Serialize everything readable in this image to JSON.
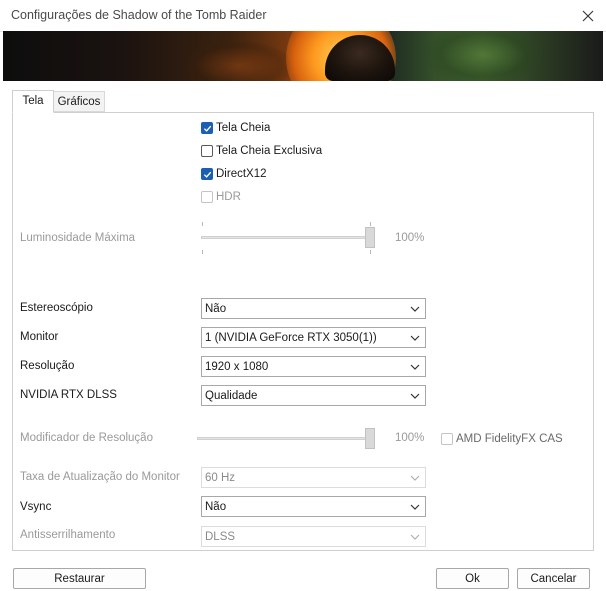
{
  "window": {
    "title": "Configurações de Shadow of the Tomb Raider"
  },
  "tabs": [
    {
      "label": "Tela",
      "active": true
    },
    {
      "label": "Gráficos",
      "active": false
    }
  ],
  "checkboxes": {
    "fullscreen": {
      "label": "Tela Cheia",
      "checked": true
    },
    "exclusive_fullscreen": {
      "label": "Tela Cheia Exclusiva",
      "checked": false
    },
    "directx12": {
      "label": "DirectX12",
      "checked": true
    },
    "hdr": {
      "label": "HDR",
      "checked": false,
      "disabled": true
    }
  },
  "brightness": {
    "label": "Luminosidade Máxima",
    "value_text": "100%",
    "value": 1.0,
    "disabled": true
  },
  "stereoscopic": {
    "label": "Estereoscópio",
    "selected": "Não"
  },
  "monitor": {
    "label": "Monitor",
    "selected": "1 (NVIDIA GeForce RTX 3050(1))"
  },
  "resolution": {
    "label": "Resolução",
    "selected": "1920 x 1080"
  },
  "dlss": {
    "label": "NVIDIA RTX DLSS",
    "selected": "Qualidade"
  },
  "resolution_modifier": {
    "label": "Modificador de Resolução",
    "value_text": "100%",
    "value": 1.0,
    "disabled": true
  },
  "amd_cas": {
    "label": "AMD FidelityFX CAS",
    "checked": false,
    "disabled": true
  },
  "refresh_rate": {
    "label": "Taxa de Atualização do Monitor",
    "selected": "60 Hz",
    "disabled": true
  },
  "vsync": {
    "label": "Vsync",
    "selected": "Não"
  },
  "antialiasing": {
    "label": "Antisserrilhamento",
    "selected": "DLSS",
    "disabled": true
  },
  "buttons": {
    "restore": "Restaurar",
    "ok": "Ok",
    "cancel": "Cancelar"
  },
  "colors": {
    "checkbox_checked": "#1a5fb4",
    "disabled_text": "#9a9a9a"
  }
}
